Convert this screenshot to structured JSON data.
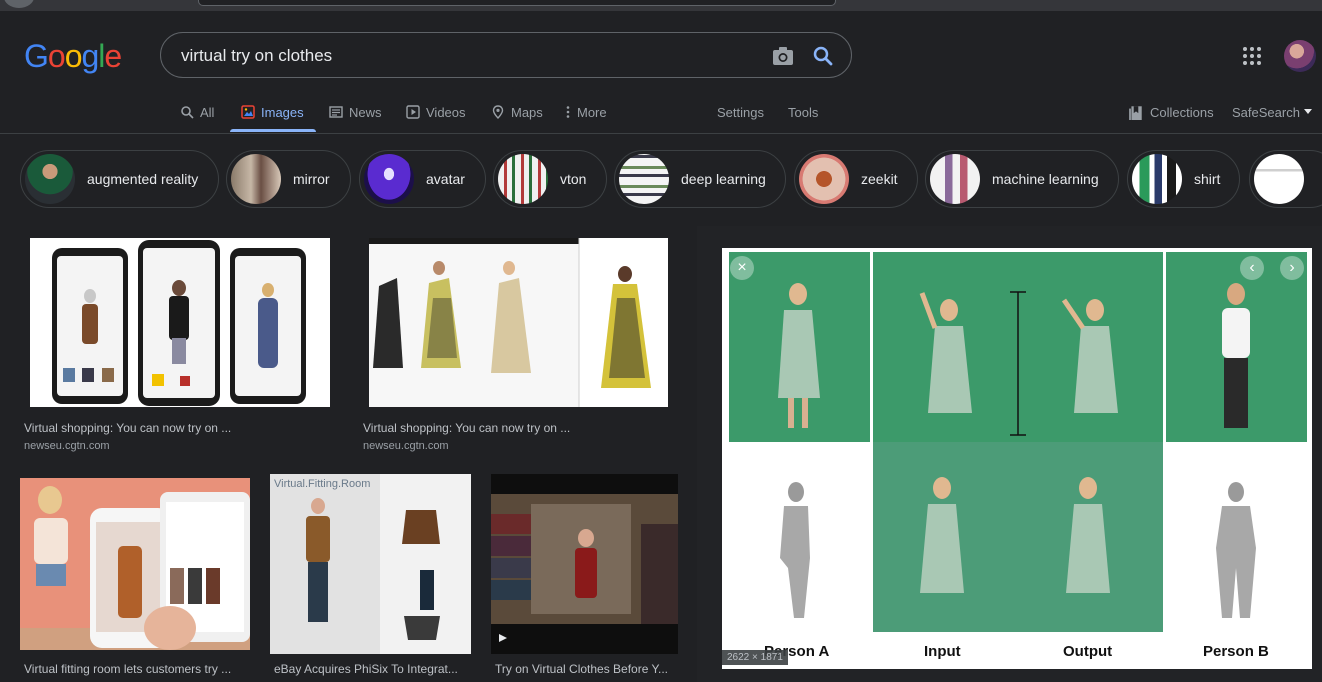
{
  "search": {
    "query": "virtual try on clothes"
  },
  "logo": {
    "letters": [
      "G",
      "o",
      "o",
      "g",
      "l",
      "e"
    ],
    "colors": [
      "#4285f4",
      "#ea4335",
      "#fbbc05",
      "#4285f4",
      "#34a853",
      "#ea4335"
    ]
  },
  "tabs": [
    {
      "label": "All",
      "icon": "search-icon"
    },
    {
      "label": "Images",
      "icon": "image-icon"
    },
    {
      "label": "News",
      "icon": "news-icon"
    },
    {
      "label": "Videos",
      "icon": "play-icon"
    },
    {
      "label": "Maps",
      "icon": "map-pin-icon"
    },
    {
      "label": "More",
      "icon": "more-vert-icon"
    }
  ],
  "tools": {
    "settings": "Settings",
    "tools": "Tools",
    "collections": "Collections",
    "safesearch": "SafeSearch"
  },
  "chips": [
    {
      "label": "augmented reality"
    },
    {
      "label": "mirror"
    },
    {
      "label": "avatar"
    },
    {
      "label": "vton"
    },
    {
      "label": "deep learning"
    },
    {
      "label": "zeekit"
    },
    {
      "label": "machine learning"
    },
    {
      "label": "shirt"
    }
  ],
  "results": [
    {
      "title": "Virtual shopping: You can now try on ...",
      "source": "newseu.cgtn.com"
    },
    {
      "title": "Virtual shopping: You can now try on ...",
      "source": "newseu.cgtn.com"
    },
    {
      "title": "Virtual fitting room lets customers try ..."
    },
    {
      "title": "eBay Acquires PhiSix To Integrat...",
      "overlay": "Virtual.Fitting.Room"
    },
    {
      "title": "Try on Virtual Clothes Before Y..."
    }
  ],
  "preview": {
    "labels": [
      "Person A",
      "Input",
      "Output",
      "Person B"
    ],
    "dimensions": "2622 × 1871"
  },
  "colors": {
    "accent": "#8ab4f8",
    "background": "#202124"
  }
}
